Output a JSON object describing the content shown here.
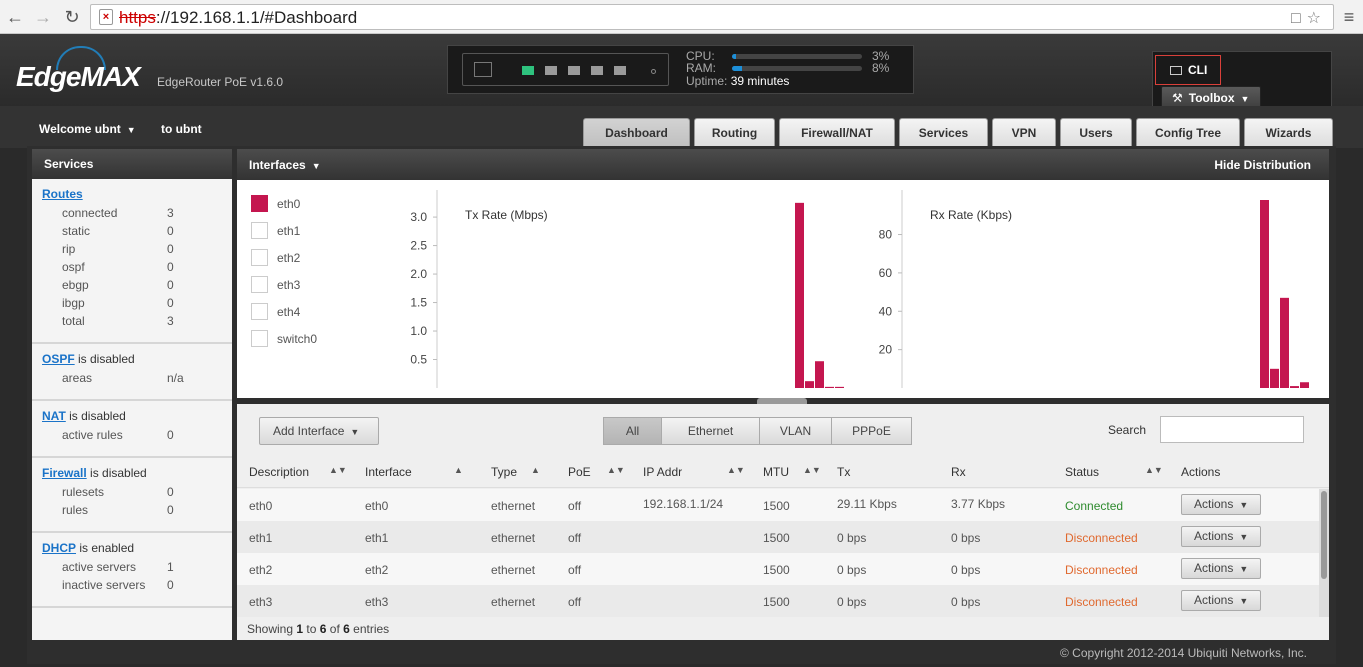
{
  "browser": {
    "url_scheme": "https",
    "url_rest": "://192.168.1.1/#Dashboard"
  },
  "header": {
    "logo": "EdgeMAX",
    "model": "EdgeRouter PoE v1.6.0",
    "cpu_label": "CPU:",
    "cpu_value": "3%",
    "cpu_fraction": 0.03,
    "ram_label": "RAM:",
    "ram_value": "8%",
    "ram_fraction": 0.08,
    "uptime_label": "Uptime:",
    "uptime_value": "39 minutes",
    "cli_label": "CLI",
    "toolbox_label": "Toolbox",
    "accent": "#1d8fd8"
  },
  "user": {
    "welcome": "Welcome ubnt",
    "to": "to ubnt"
  },
  "tabs": [
    "Dashboard",
    "Routing",
    "Firewall/NAT",
    "Services",
    "VPN",
    "Users",
    "Config Tree",
    "Wizards"
  ],
  "sidebar": {
    "title": "Services",
    "routes": {
      "title": "Routes",
      "rows": [
        {
          "k": "connected",
          "v": "3"
        },
        {
          "k": "static",
          "v": "0"
        },
        {
          "k": "rip",
          "v": "0"
        },
        {
          "k": "ospf",
          "v": "0"
        },
        {
          "k": "ebgp",
          "v": "0"
        },
        {
          "k": "ibgp",
          "v": "0"
        },
        {
          "k": "total",
          "v": "3"
        }
      ]
    },
    "ospf": {
      "title": "OSPF",
      "status": " is disabled",
      "rows": [
        {
          "k": "areas",
          "v": "n/a"
        }
      ]
    },
    "nat": {
      "title": "NAT",
      "status": " is disabled",
      "rows": [
        {
          "k": "active rules",
          "v": "0"
        }
      ]
    },
    "firewall": {
      "title": "Firewall",
      "status": " is disabled",
      "rows": [
        {
          "k": "rulesets",
          "v": "0"
        },
        {
          "k": "rules",
          "v": "0"
        }
      ]
    },
    "dhcp": {
      "title": "DHCP",
      "status": " is enabled",
      "rows": [
        {
          "k": "active servers",
          "v": "1"
        },
        {
          "k": "inactive servers",
          "v": "0"
        }
      ]
    }
  },
  "interfaces": {
    "title": "Interfaces",
    "hide_distribution": "Hide Distribution",
    "legend": [
      {
        "name": "eth0",
        "on": true
      },
      {
        "name": "eth1",
        "on": false
      },
      {
        "name": "eth2",
        "on": false
      },
      {
        "name": "eth3",
        "on": false
      },
      {
        "name": "eth4",
        "on": false
      },
      {
        "name": "switch0",
        "on": false
      }
    ],
    "bar_color": "#c4164f"
  },
  "chart_data": [
    {
      "type": "bar",
      "title": "Tx Rate (Mbps)",
      "yticks": [
        "3.0",
        "2.5",
        "2.0",
        "1.5",
        "1.0",
        "0.5"
      ],
      "ylim": [
        0,
        3.3
      ],
      "values": [
        3.25,
        0.12,
        0.47,
        0.02,
        0.02
      ]
    },
    {
      "type": "bar",
      "title": "Rx Rate (Kbps)",
      "yticks": [
        "80",
        "60",
        "40",
        "20"
      ],
      "ylim": [
        0,
        98
      ],
      "values": [
        98,
        10,
        47,
        1,
        3
      ]
    }
  ],
  "table": {
    "add_interface": "Add Interface",
    "filters": [
      "All",
      "Ethernet",
      "VLAN",
      "PPPoE"
    ],
    "search_label": "Search",
    "headers": [
      "Description",
      "Interface",
      "Type",
      "PoE",
      "IP Addr",
      "MTU",
      "Tx",
      "Rx",
      "Status",
      "Actions"
    ],
    "rows": [
      {
        "desc": "eth0",
        "iface": "eth0",
        "type": "ethernet",
        "poe": "off",
        "ip": "192.168.1.1/24",
        "mtu": "1500",
        "tx": "29.11 Kbps",
        "rx": "3.77 Kbps",
        "status": "Connected",
        "action": "Actions"
      },
      {
        "desc": "eth1",
        "iface": "eth1",
        "type": "ethernet",
        "poe": "off",
        "ip": "",
        "mtu": "1500",
        "tx": "0 bps",
        "rx": "0 bps",
        "status": "Disconnected",
        "action": "Actions"
      },
      {
        "desc": "eth2",
        "iface": "eth2",
        "type": "ethernet",
        "poe": "off",
        "ip": "",
        "mtu": "1500",
        "tx": "0 bps",
        "rx": "0 bps",
        "status": "Disconnected",
        "action": "Actions"
      },
      {
        "desc": "eth3",
        "iface": "eth3",
        "type": "ethernet",
        "poe": "off",
        "ip": "",
        "mtu": "1500",
        "tx": "0 bps",
        "rx": "0 bps",
        "status": "Disconnected",
        "action": "Actions"
      }
    ],
    "showing_prefix": "Showing ",
    "showing_from": "1",
    "showing_to_word": " to ",
    "showing_to": "6",
    "showing_of_word": " of ",
    "showing_total": "6",
    "showing_suffix": " entries"
  },
  "footer": "© Copyright 2012-2014 Ubiquiti Networks, Inc."
}
